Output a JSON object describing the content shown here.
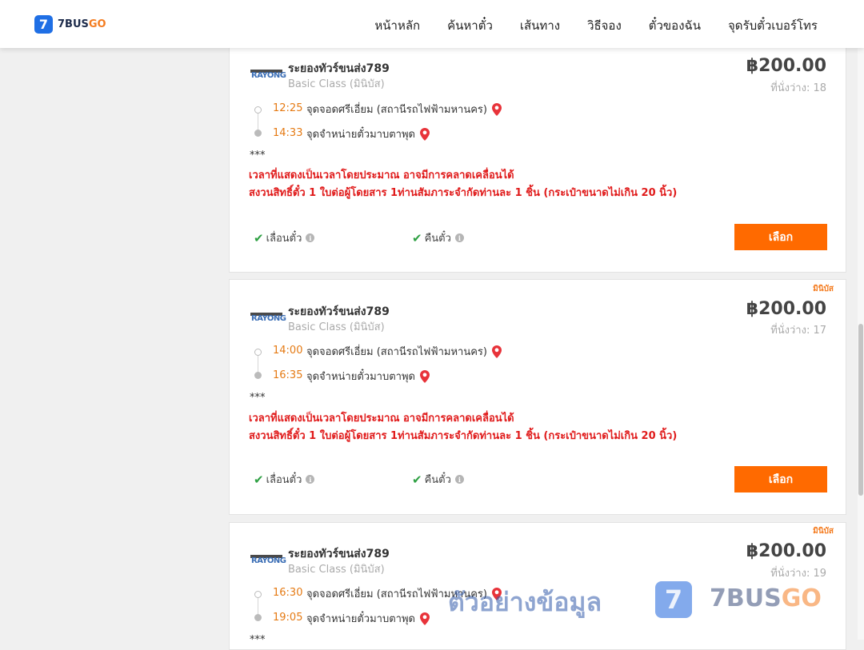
{
  "header": {
    "logo_mark": "7",
    "logo_text_a": "7BUS",
    "logo_text_b": "GO",
    "nav": [
      "หน้าหลัก",
      "ค้นหาตั๋ว",
      "เส้นทาง",
      "วิธีจอง",
      "ตั๋วของฉัน",
      "จุดรับตั๋วเบอร์โทร"
    ]
  },
  "trips": [
    {
      "operator_logo": "RAYONG",
      "operator": "ระยองทัวร์ขนส่ง789",
      "class": "Basic Class (มินิบัส)",
      "price": "฿200.00",
      "seats": "ที่นั่งว่าง: 18",
      "tag": "",
      "depart_time": "12:25",
      "depart_stop": "จุดจอดศรีเอี่ยม (สถานีรถไฟฟ้ามหานคร)",
      "arrive_time": "14:33",
      "arrive_stop": "จุดจำหน่ายตั๋วมาบตาพุด",
      "stars": "***",
      "note1": "เวลาที่แสดงเป็นเวลาโดยประมาณ อาจมีการคลาดเคลื่อนได้",
      "note2": "สงวนสิทธิ์ตั๋ว 1 ใบต่อผู้โดยสาร 1ท่านสัมภาระจำกัดท่านละ 1 ชิ้น (กระเป๋าขนาดไม่เกิน 20 นิ้ว)",
      "policy1": "เลื่อนตั๋ว",
      "policy2": "คืนตั๋ว",
      "button": "เลือก"
    },
    {
      "operator_logo": "RAYONG",
      "operator": "ระยองทัวร์ขนส่ง789",
      "class": "Basic Class (มินิบัส)",
      "price": "฿200.00",
      "seats": "ที่นั่งว่าง: 17",
      "tag": "มินิบัส",
      "depart_time": "14:00",
      "depart_stop": "จุดจอดศรีเอี่ยม (สถานีรถไฟฟ้ามหานคร)",
      "arrive_time": "16:35",
      "arrive_stop": "จุดจำหน่ายตั๋วมาบตาพุด",
      "stars": "***",
      "note1": "เวลาที่แสดงเป็นเวลาโดยประมาณ อาจมีการคลาดเคลื่อนได้",
      "note2": "สงวนสิทธิ์ตั๋ว 1 ใบต่อผู้โดยสาร 1ท่านสัมภาระจำกัดท่านละ 1 ชิ้น (กระเป๋าขนาดไม่เกิน 20 นิ้ว)",
      "policy1": "เลื่อนตั๋ว",
      "policy2": "คืนตั๋ว",
      "button": "เลือก"
    },
    {
      "operator_logo": "RAYONG",
      "operator": "ระยองทัวร์ขนส่ง789",
      "class": "Basic Class (มินิบัส)",
      "price": "฿200.00",
      "seats": "ที่นั่งว่าง: 19",
      "tag": "มินิบัส",
      "depart_time": "16:30",
      "depart_stop": "จุดจอดศรีเอี่ยม (สถานีรถไฟฟ้ามหานคร)",
      "arrive_time": "19:05",
      "arrive_stop": "จุดจำหน่ายตั๋วมาบตาพุด",
      "stars": "***"
    }
  ],
  "watermark": {
    "text": "ตัวอย่างข้อมูล",
    "logo_mark": "7",
    "logo_text_a": "7BUS",
    "logo_text_b": "GO"
  }
}
